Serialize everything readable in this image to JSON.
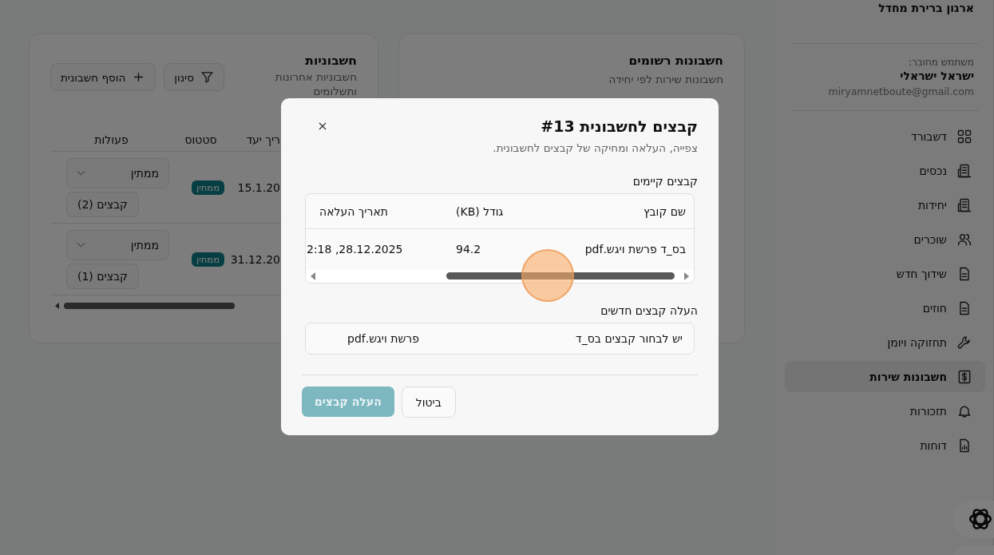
{
  "sidebar": {
    "org_name": "ארגון ברירת מחדל",
    "user_label": "משתמש מחובר:",
    "user_name": "ישראל ישראלי",
    "email": "miryamnetboute@gmail.com",
    "items": [
      {
        "label": "דשבורד",
        "selected": false
      },
      {
        "label": "נכסים",
        "selected": false
      },
      {
        "label": "יחידות",
        "selected": false
      },
      {
        "label": "שוכרים",
        "selected": false
      },
      {
        "label": "שידוך חדש",
        "selected": false
      },
      {
        "label": "חוזים",
        "selected": false
      },
      {
        "label": "תחזוקה ויומן",
        "selected": false
      },
      {
        "label": "חשבונות שירות",
        "selected": true
      },
      {
        "label": "תזכורות",
        "selected": false
      },
      {
        "label": "דוחות",
        "selected": false
      }
    ]
  },
  "registered_card": {
    "title": "חשבונות רשומים",
    "subtitle": "חשבונות שירות לפי יחידה"
  },
  "invoices_card": {
    "title": "חשבוניות",
    "subtitle": "חשבוניות אחרונות ותשלומים",
    "filter_button": "סינון",
    "add_button": "הוסף חשבונית",
    "columns": [
      "ריך יעד",
      "סטטוס",
      "פעולות"
    ],
    "rows": [
      {
        "due_date": "15.1.20",
        "status": "ממתין",
        "status_select": "ממתין",
        "files_button": "קבצים (2)"
      },
      {
        "due_date": "31.12.20",
        "status": "ממתין",
        "status_select": "ממתין",
        "files_button": "קבצים (1)"
      }
    ]
  },
  "dialog": {
    "title": "קבצים לחשבונית #13",
    "subtitle": "צפייה, העלאה ומחיקה של קבצים לחשבונית.",
    "existing_label": "קבצים קיימים",
    "columns": [
      "שם קובץ",
      "גודל (KB)",
      "תאריך העלאה"
    ],
    "rows": [
      {
        "name": "בס_ד פרשת ויגש.pdf",
        "size": "94.2",
        "uploaded": "28.12.2025, 2:18"
      }
    ],
    "upload_label": "העלה קבצים חדשים",
    "choose_label": "יש לבחור קבצים בס_ד",
    "chosen_file": "פרשת ויגש.pdf",
    "cancel_button": "ביטול",
    "upload_button": {
      "label": "העלה קבצים",
      "disabled": true
    }
  }
}
